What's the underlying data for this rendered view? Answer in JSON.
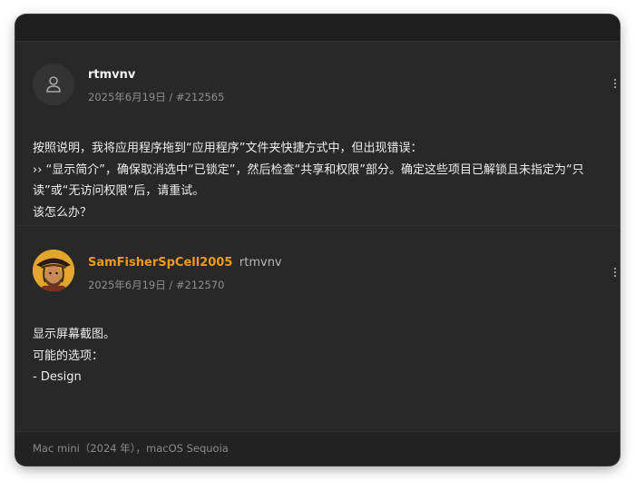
{
  "posts": [
    {
      "author": "rtmvnv",
      "date": "2025年6月19日",
      "post_id": "/ #212565",
      "avatar_icon": "user-icon",
      "lines": [
        "按照说明，我将应用程序拖到“应用程序”文件夹快捷方式中，但出现错误：",
        "›› “显示简介”，确保取消选中“已锁定”，然后检查“共享和权限”部分。确定这些项目已解锁且未指定为“只读”或“无访问权限”后，请重试。",
        "该怎么办？"
      ]
    },
    {
      "author": "SamFisherSpCell2005",
      "reply_to": "rtmvnv",
      "date": "2025年6月19日",
      "post_id": "/ #212570",
      "avatar_icon": "pirate-avatar-icon",
      "accent_color": "#f09a1c",
      "lines": [
        "显示屏幕截图。",
        "可能的选项：",
        "- Design"
      ]
    }
  ],
  "footer": {
    "system_info": "Mac mini（2024 年），macOS Sequoia"
  }
}
